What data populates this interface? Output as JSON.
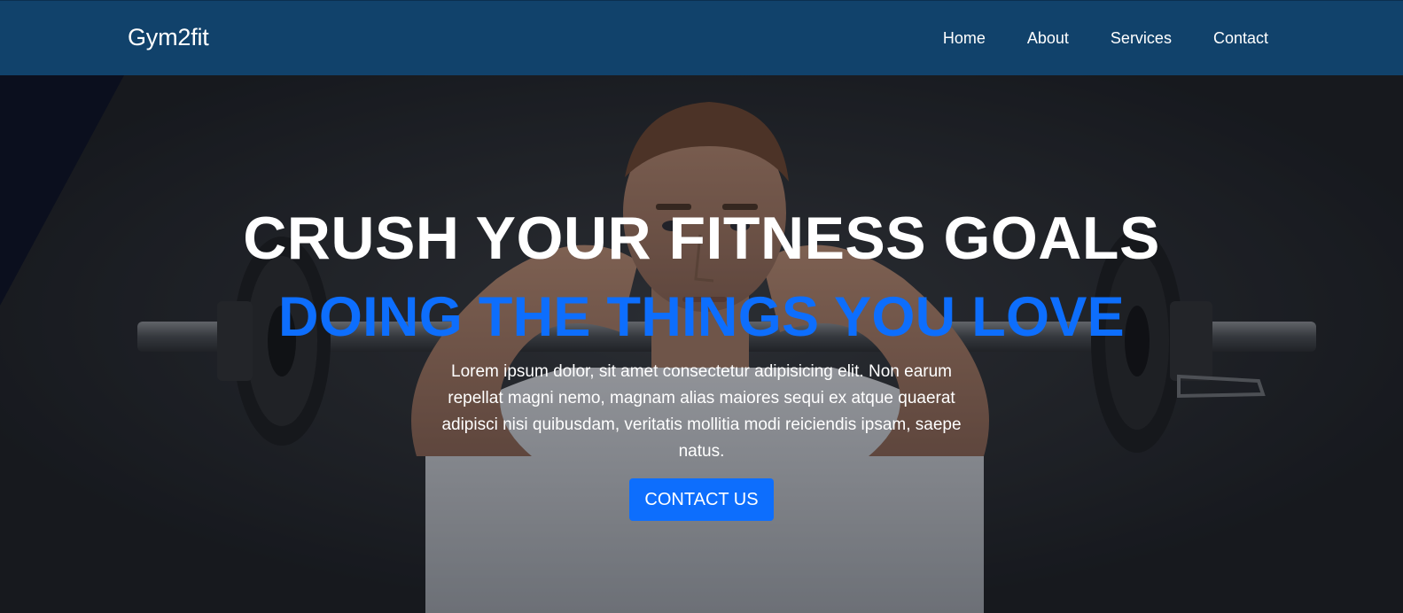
{
  "nav": {
    "brand": "Gym2fit",
    "links": [
      "Home",
      "About",
      "Services",
      "Contact"
    ],
    "background": "#11426b"
  },
  "hero": {
    "headline": "CRUSH YOUR FITNESS GOALS",
    "subheadline": "DOING THE THINGS YOU LOVE",
    "body": "Lorem ipsum dolor, sit amet consectetur adipisicing elit. Non earum repellat magni nemo, magnam alias maiores sequi ex atque quaerat adipisci nisi quibusdam, veritatis mollitia modi reiciendis ipsam, saepe natus.",
    "cta_label": "CONTACT US",
    "accent_color": "#0d6efd",
    "background_image": "man-lifting-barbell-behind-head"
  }
}
